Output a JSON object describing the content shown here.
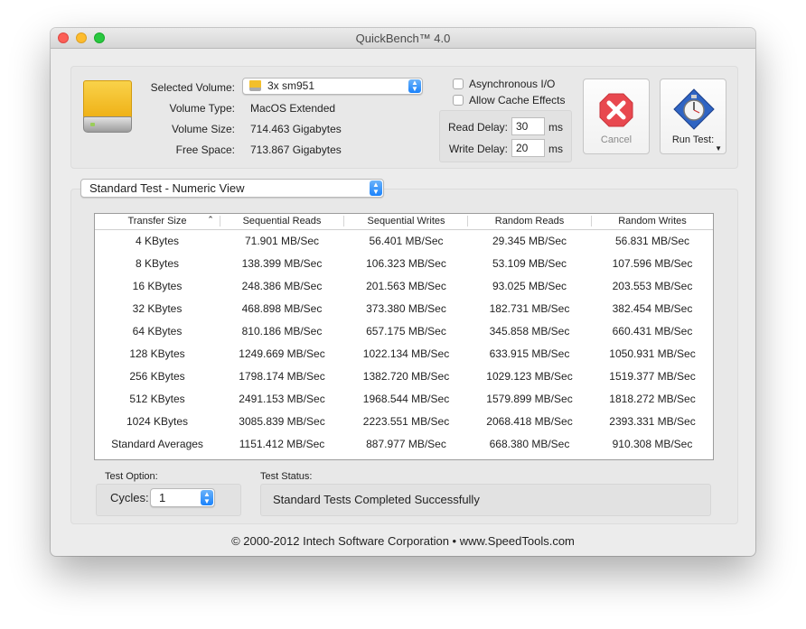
{
  "window": {
    "title": "QuickBench™ 4.0"
  },
  "volume": {
    "selected_label": "Selected Volume:",
    "selected_value": "3x sm951",
    "type_label": "Volume Type:",
    "type_value": "MacOS Extended",
    "size_label": "Volume Size:",
    "size_value": "714.463 Gigabytes",
    "free_label": "Free Space:",
    "free_value": "713.867 Gigabytes"
  },
  "options": {
    "async_label": "Asynchronous I/O",
    "async_checked": false,
    "cache_label": "Allow Cache Effects",
    "cache_checked": false,
    "read_delay_label": "Read Delay:",
    "read_delay_value": "30",
    "write_delay_label": "Write Delay:",
    "write_delay_value": "20",
    "unit": "ms"
  },
  "buttons": {
    "cancel_label": "Cancel",
    "run_label": "Run Test:"
  },
  "view": {
    "selected": "Standard Test - Numeric View"
  },
  "table": {
    "columns": [
      "Transfer Size",
      "Sequential Reads",
      "Sequential Writes",
      "Random Reads",
      "Random Writes"
    ],
    "rows": [
      [
        "4 KBytes",
        "71.901 MB/Sec",
        "56.401 MB/Sec",
        "29.345 MB/Sec",
        "56.831 MB/Sec"
      ],
      [
        "8 KBytes",
        "138.399 MB/Sec",
        "106.323 MB/Sec",
        "53.109 MB/Sec",
        "107.596 MB/Sec"
      ],
      [
        "16 KBytes",
        "248.386 MB/Sec",
        "201.563 MB/Sec",
        "93.025 MB/Sec",
        "203.553 MB/Sec"
      ],
      [
        "32 KBytes",
        "468.898 MB/Sec",
        "373.380 MB/Sec",
        "182.731 MB/Sec",
        "382.454 MB/Sec"
      ],
      [
        "64 KBytes",
        "810.186 MB/Sec",
        "657.175 MB/Sec",
        "345.858 MB/Sec",
        "660.431 MB/Sec"
      ],
      [
        "128 KBytes",
        "1249.669 MB/Sec",
        "1022.134 MB/Sec",
        "633.915 MB/Sec",
        "1050.931 MB/Sec"
      ],
      [
        "256 KBytes",
        "1798.174 MB/Sec",
        "1382.720 MB/Sec",
        "1029.123 MB/Sec",
        "1519.377 MB/Sec"
      ],
      [
        "512 KBytes",
        "2491.153 MB/Sec",
        "1968.544 MB/Sec",
        "1579.899 MB/Sec",
        "1818.272 MB/Sec"
      ],
      [
        "1024 KBytes",
        "3085.839 MB/Sec",
        "2223.551 MB/Sec",
        "2068.418 MB/Sec",
        "2393.331 MB/Sec"
      ],
      [
        "Standard Averages",
        "1151.412 MB/Sec",
        "887.977 MB/Sec",
        "668.380 MB/Sec",
        "910.308 MB/Sec"
      ]
    ]
  },
  "test_option": {
    "label": "Test Option:",
    "cycles_label": "Cycles:",
    "cycles_value": "1"
  },
  "test_status": {
    "label": "Test Status:",
    "message": "Standard Tests Completed Successfully"
  },
  "footer": {
    "text": "© 2000-2012 Intech Software Corporation • www.SpeedTools.com"
  },
  "colors": {
    "accent": "#1a82fb",
    "cancel_red": "#e8484f",
    "disk_yellow": "#f3bf2b"
  }
}
